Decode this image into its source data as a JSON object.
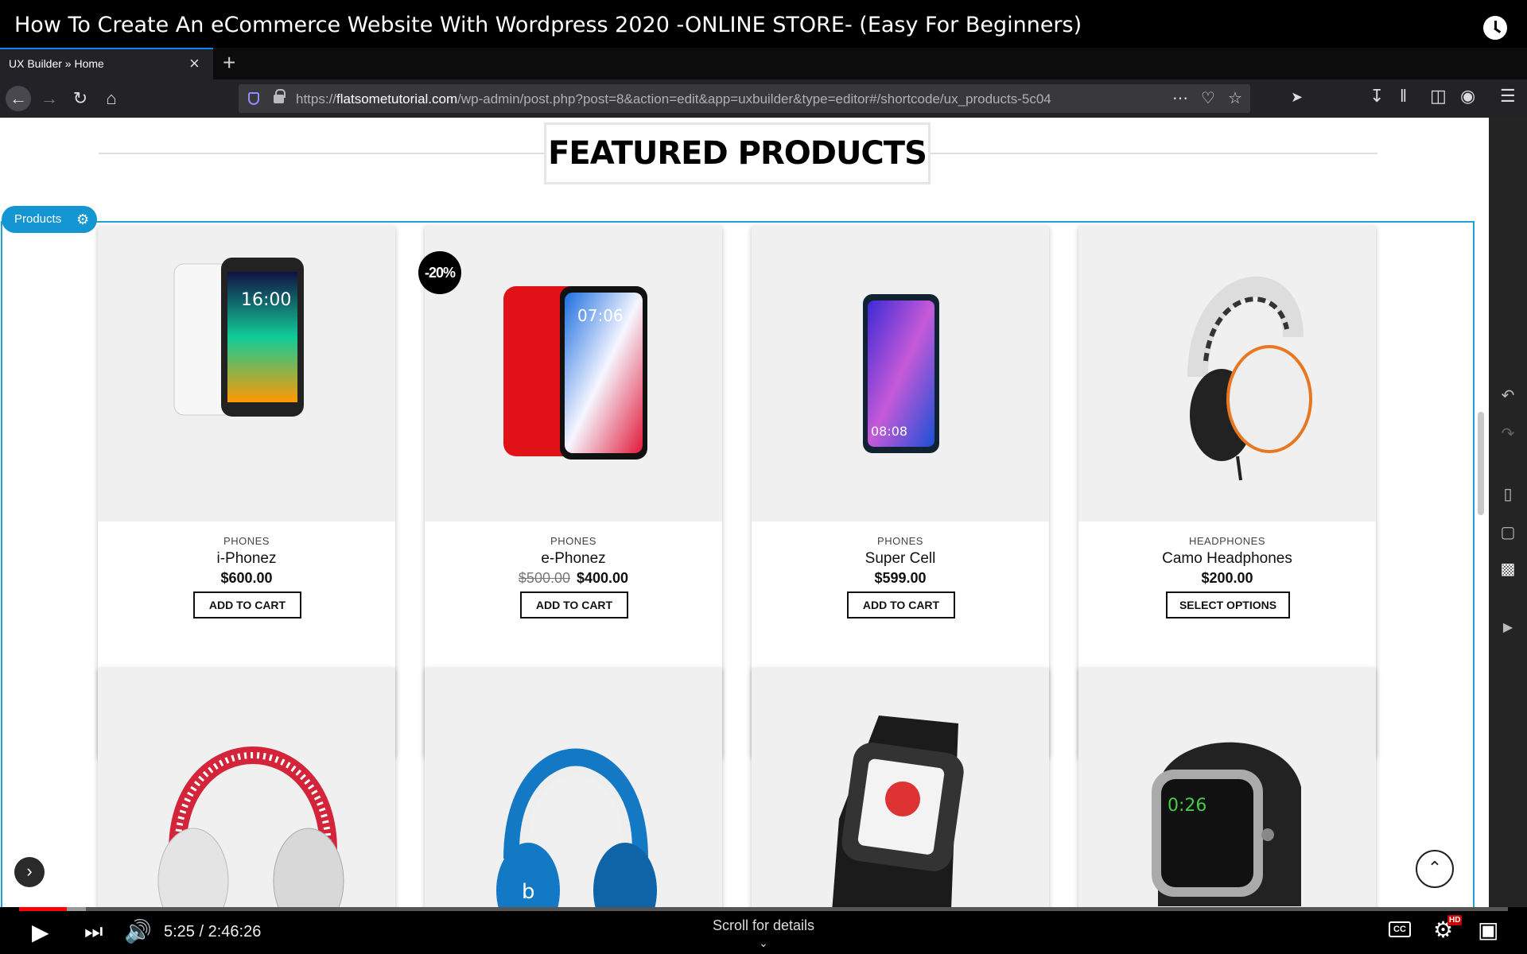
{
  "video": {
    "title": "How To Create An eCommerce Website With Wordpress 2020 -ONLINE STORE- (Easy For Beginners)",
    "time": "5:25 / 2:46:26",
    "scroll_hint": "Scroll for details",
    "played_fraction": 0.032,
    "buffered_fraction": 0.045
  },
  "browser": {
    "tab_title": "UX Builder » Home",
    "url_prefix": "https://",
    "url_host": "flatsometutorial.com",
    "url_path": "/wp-admin/post.php?post=8&action=edit&app=uxbuilder&type=editor#/shortcode/ux_products-5c04"
  },
  "page": {
    "section_title": "FEATURED PRODUCTS",
    "element_tag": "Products"
  },
  "products": [
    {
      "category": "PHONES",
      "name": "i-Phonez",
      "price": "$600.00",
      "old_price": "",
      "button": "ADD TO CART"
    },
    {
      "category": "PHONES",
      "name": "e-Phonez",
      "price": "$400.00",
      "old_price": "$500.00",
      "button": "ADD TO CART",
      "badge": "-20%"
    },
    {
      "category": "PHONES",
      "name": "Super Cell",
      "price": "$599.00",
      "old_price": "",
      "button": "ADD TO CART"
    },
    {
      "category": "HEADPHONES",
      "name": "Camo Headphones",
      "price": "$200.00",
      "old_price": "",
      "button": "SELECT OPTIONS"
    }
  ],
  "images": {
    "p1": {
      "bg": "#f0f0f0",
      "screen_time": "16:00"
    },
    "p2": {
      "bg": "#f0f0f0",
      "screen_time": "07:06"
    },
    "p3": {
      "bg": "#f0f0f0",
      "screen_time": "08:08"
    },
    "watch2": {
      "screen_time": "0:26"
    }
  },
  "colors": {
    "accent": "#1496d2",
    "progress": "#ff0000"
  }
}
